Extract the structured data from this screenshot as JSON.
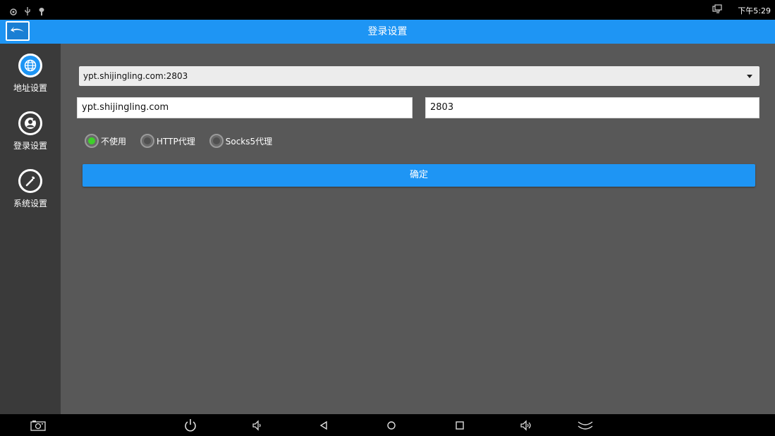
{
  "status_bar": {
    "time": "下午5:29",
    "left_icons": [
      "notification-icon",
      "usb-icon",
      "debug-icon"
    ],
    "right_icons": [
      "multi-window-icon"
    ]
  },
  "title_bar": {
    "title": "登录设置",
    "back_icon": "back-arrow-icon"
  },
  "sidebar": {
    "items": [
      {
        "label": "地址设置",
        "icon": "globe-icon",
        "active": true
      },
      {
        "label": "登录设置",
        "icon": "user-icon",
        "active": false
      },
      {
        "label": "系统设置",
        "icon": "wrench-icon",
        "active": false
      }
    ]
  },
  "form": {
    "server_select": {
      "value": "ypt.shijingling.com:2803"
    },
    "host_input": {
      "value": "ypt.shijingling.com"
    },
    "port_input": {
      "value": "2803"
    },
    "proxy_options": [
      {
        "label": "不使用",
        "checked": true
      },
      {
        "label": "HTTP代理",
        "checked": false
      },
      {
        "label": "Socks5代理",
        "checked": false
      }
    ],
    "confirm_label": "确定"
  },
  "nav_bar": {
    "buttons": [
      "screenshot-icon",
      "power-icon",
      "volume-down-icon",
      "back-icon",
      "home-icon",
      "recents-icon",
      "volume-up-icon",
      "hide-bar-icon"
    ]
  },
  "colors": {
    "accent": "#1e95f4",
    "main_bg": "#585858",
    "sidebar_bg": "#3a3a3a",
    "radio_checked": "#3ecf2a"
  }
}
